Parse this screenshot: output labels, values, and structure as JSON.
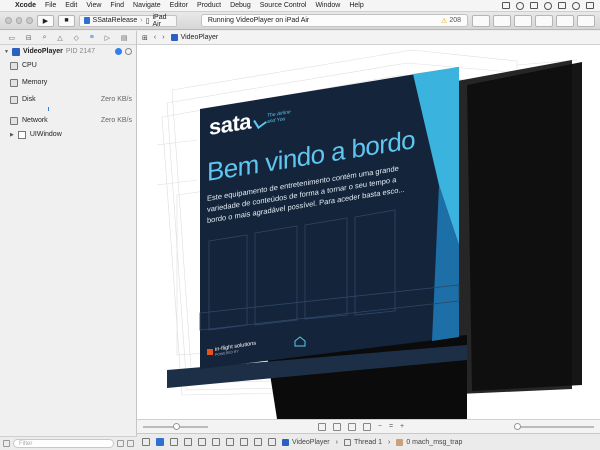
{
  "menubar": {
    "app": "Xcode",
    "items": [
      "File",
      "Edit",
      "View",
      "Find",
      "Navigate",
      "Editor",
      "Product",
      "Debug",
      "Source Control",
      "Window",
      "Help"
    ]
  },
  "toolbar": {
    "scheme": "SSataRelease",
    "device": "iPad Air",
    "status": "Running VideoPlayer on iPad Air",
    "warning_count": "208"
  },
  "navigator": {
    "process": {
      "name": "VideoPlayer",
      "pid": "PID 2147"
    },
    "gauges": [
      {
        "label": "CPU",
        "value": ""
      },
      {
        "label": "Memory",
        "value": ""
      },
      {
        "label": "Disk",
        "value": "Zero KB/s"
      },
      {
        "label": "Network",
        "value": "Zero KB/s"
      }
    ],
    "tree": [
      {
        "label": "UIWindow"
      }
    ],
    "filter_placeholder": "Filter"
  },
  "jumpbar": {
    "crumb": "VideoPlayer"
  },
  "screen": {
    "brand": "sata",
    "tagline_1": "The Airline",
    "tagline_2": "and You",
    "title": "Bem vindo a bordo",
    "body_1": "Este equipamento de entretenimento contém uma grande",
    "body_2": "variedade de conteúdos de forma a tornar o seu tempo a",
    "body_3": "bordo o mais agradável possível. Para aceder basta esco...",
    "footer_brand": "in-flight solutions",
    "footer_small": "POWERED BY"
  },
  "debugbar": {
    "process": "VideoPlayer",
    "thread": "Thread 1",
    "frame": "0 mach_msg_trap"
  },
  "colors": {
    "screen_navy": "#14243a",
    "screen_cyan": "#3ab3de",
    "accent_blue": "#2f7ff0"
  }
}
